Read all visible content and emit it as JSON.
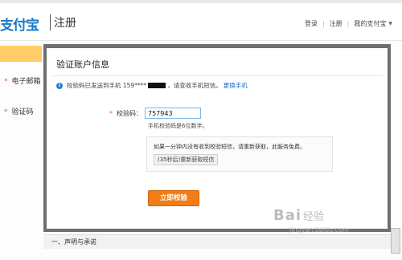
{
  "header": {
    "logo": "支付宝",
    "page_title": "注册",
    "nav": {
      "login": "登录",
      "register": "注册",
      "my_alipay": "我的支付宝"
    }
  },
  "background": {
    "side_items": [
      "电子邮箱",
      "验证码"
    ],
    "section_label": "一、声明与承诺"
  },
  "modal": {
    "title": "验证账户信息",
    "info_prefix": "校验码已发送到手机 159****",
    "info_suffix": "，请查收手机短信。",
    "change_phone": "更换手机",
    "code_label": "校验码：",
    "code_value": "757943",
    "hint": "手机校验码是6位数字。",
    "tip_text": "如果一分钟内没有收到校验短信，请重新获取，此服务免费。",
    "resend_label": "(35秒后)重新获取短信",
    "confirm_label": "立即校验"
  },
  "watermark": {
    "brand": "Bai",
    "brand_suffix": "经验",
    "url": "jingyan.baidu.com"
  },
  "colors": {
    "accent": "#f07d17",
    "link": "#1a6fc4",
    "brand_blue": "#1b7ac8",
    "highlight_bar": "#ffcc66"
  },
  "icons": {
    "info": "info-circle-icon",
    "required": "asterisk-icon",
    "dropdown": "chevron-down-icon"
  }
}
